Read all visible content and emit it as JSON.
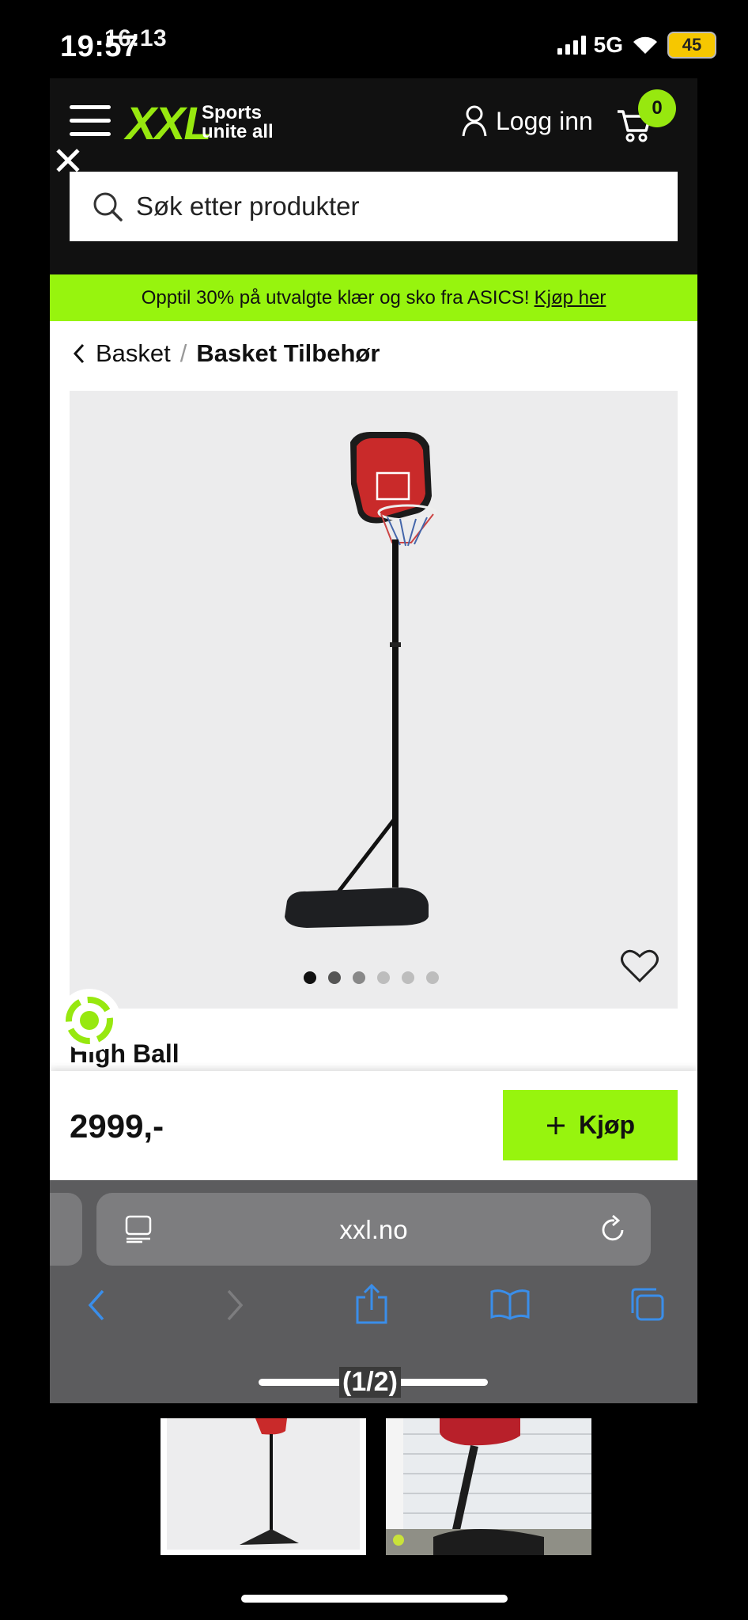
{
  "status": {
    "time": "19:57",
    "time_overlay": "16:13",
    "network": "5G",
    "battery": "45"
  },
  "header": {
    "logo": "XXL",
    "tagline_line1": "Sports",
    "tagline_line2": "unite all",
    "login_label": "Logg inn",
    "cart_count": "0",
    "close_label": "✕"
  },
  "search": {
    "placeholder": "Søk etter produkter"
  },
  "promo": {
    "text": "Opptil 30% på utvalgte klær og sko fra ASICS!",
    "link": "Kjøp her"
  },
  "breadcrumb": {
    "parent": "Basket",
    "separator": "/",
    "current": "Basket Tilbehør"
  },
  "product": {
    "name": "High Ball",
    "price": "2999,-",
    "buy_label": "Kjøp",
    "image_count": 6,
    "active_image": 1
  },
  "browser": {
    "url": "xxl.no",
    "page_counter": "(1/2)"
  },
  "colors": {
    "brand_green": "#97f40e",
    "header_bg": "#111111"
  },
  "icons": [
    "menu-icon",
    "user-icon",
    "cart-icon",
    "close-icon",
    "search-icon",
    "chevron-left-icon",
    "heart-icon",
    "eco-icon",
    "plus-icon",
    "reader-icon",
    "reload-icon",
    "back-icon",
    "forward-icon",
    "share-icon",
    "bookmarks-icon",
    "tabs-icon"
  ]
}
